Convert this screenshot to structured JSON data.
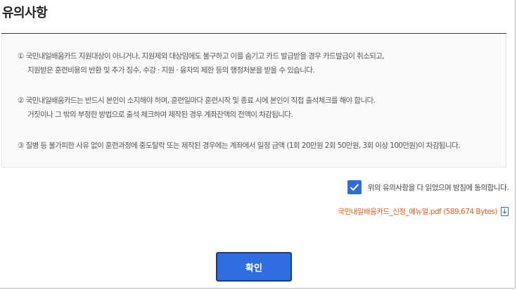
{
  "title": "유의사항",
  "notices": [
    {
      "line1": "① 국민내일배움카드 지원대상이 아니거나, 지원제외 대상임에도 불구하고 이를 숨기고 카드 발급받을 경우 카드발급이 취소되고,",
      "line2": "지원받은 훈련비용의 반환 및 추가 징수, 수강 · 지원 · 융자의 제한 등의 행정처분을 받을 수 있습니다."
    },
    {
      "line1": "② 국민내일배움카드는 반드시 본인이 소지해야 하며, 훈련일마다 훈련시작 및 종료 시에 본인이 직접 출석체크를 해야 합니다.",
      "line2": "거짓이나 그 밖의 부정한 방법으로 출석 체크하여 제작된 경우 계좌잔액의 전액이 차감됩니다."
    },
    {
      "line1": "③ 질병 등 불가피한 사유 없이 훈련과정에 중도탈락 또는 제작된 경우에는 계좌에서 일정 금액 (1회 20만원 2회 50만원, 3회 이상 100만원)이 차감됩니다."
    }
  ],
  "agreement": {
    "label": "위의 유의사항을 다 읽었으며 방침에 동의합니다.",
    "checked": true
  },
  "file": {
    "link_text": "국민내일배움카드_신청_매뉴얼.pdf (589,674 Bytes)",
    "icon": "download-icon"
  },
  "confirm_label": "확인",
  "colors": {
    "accent": "#2f6ee0",
    "file_link": "#e0601f",
    "title_rule": "#2f3a5c"
  }
}
